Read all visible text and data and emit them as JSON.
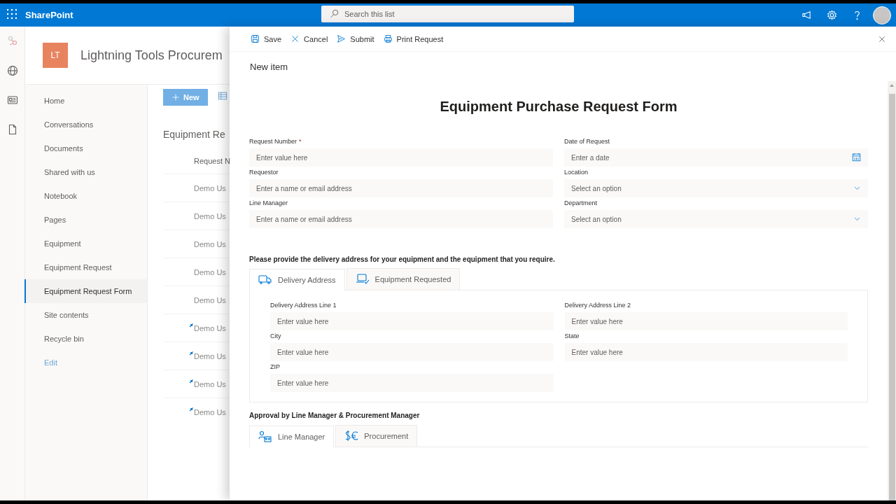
{
  "top_bar": {
    "app_name": "SharePoint",
    "search": {
      "placeholder": "Search this list"
    }
  },
  "site": {
    "logo": "LT",
    "title": "Lightning Tools Procurem"
  },
  "nav": [
    {
      "label": "Home",
      "kind": "page",
      "selected": false
    },
    {
      "label": "Conversations",
      "kind": "page",
      "selected": false
    },
    {
      "label": "Documents",
      "kind": "page",
      "selected": false
    },
    {
      "label": "Shared with us",
      "kind": "page",
      "selected": false
    },
    {
      "label": "Notebook",
      "kind": "page",
      "selected": false
    },
    {
      "label": "Pages",
      "kind": "page",
      "selected": false
    },
    {
      "label": "Equipment",
      "kind": "page",
      "selected": false
    },
    {
      "label": "Equipment Request",
      "kind": "page",
      "selected": false
    },
    {
      "label": "Equipment Request Form",
      "kind": "page",
      "selected": true
    },
    {
      "label": "Site contents",
      "kind": "page",
      "selected": false
    },
    {
      "label": "Recycle bin",
      "kind": "page",
      "selected": false
    },
    {
      "label": "Edit",
      "kind": "link",
      "selected": false
    }
  ],
  "list": {
    "new_button": "New",
    "title": "Equipment Re",
    "column": "Request N",
    "rows": [
      {
        "text": "Demo Us",
        "new": false
      },
      {
        "text": "Demo Us",
        "new": false
      },
      {
        "text": "Demo Us",
        "new": false
      },
      {
        "text": "Demo Us",
        "new": false
      },
      {
        "text": "Demo Us",
        "new": false
      },
      {
        "text": "Demo Us",
        "new": true
      },
      {
        "text": "Demo Us",
        "new": true
      },
      {
        "text": "Demo Us",
        "new": true
      },
      {
        "text": "Demo Us",
        "new": true
      }
    ]
  },
  "panel": {
    "commands": [
      {
        "label": "Save",
        "kind": "save"
      },
      {
        "label": "Cancel",
        "kind": "cancel"
      },
      {
        "label": "Submit",
        "kind": "submit"
      },
      {
        "label": "Print Request",
        "kind": "print"
      }
    ],
    "heading": "New item",
    "form_title": "Equipment Purchase Request Form",
    "fields": [
      {
        "label": "Request Number",
        "required_mark": "*",
        "placeholder": "Enter value here",
        "kind": "text"
      },
      {
        "label": "Date of Request",
        "placeholder": "Enter a date",
        "kind": "date"
      },
      {
        "label": "Requestor",
        "placeholder": "Enter a name or email address",
        "kind": "text"
      },
      {
        "label": "Location",
        "placeholder": "Select an option",
        "kind": "choice"
      },
      {
        "label": "Line Manager",
        "placeholder": "Enter a name or email address",
        "kind": "text"
      },
      {
        "label": "Department",
        "placeholder": "Select an option",
        "kind": "choice"
      }
    ],
    "delivery_intro": "Please provide the delivery address for your equipment and the equipment that you require.",
    "delivery_tabs": [
      {
        "label": "Delivery Address",
        "kind": "truck",
        "selected": true
      },
      {
        "label": "Equipment Requested",
        "kind": "laptop",
        "selected": false
      }
    ],
    "delivery_fields": [
      {
        "label": "Delivery Address Line 1",
        "placeholder": "Enter value here"
      },
      {
        "label": "Delivery Address Line 2",
        "placeholder": "Enter value here"
      },
      {
        "label": "City",
        "placeholder": "Enter value here"
      },
      {
        "label": "State",
        "placeholder": "Enter value here"
      },
      {
        "label": "ZIP",
        "placeholder": "Enter value here"
      }
    ],
    "approval_heading": "Approval by Line Manager & Procurement Manager",
    "approval_tabs": [
      {
        "label": "Line Manager",
        "kind": "people",
        "selected": true
      },
      {
        "label": "Procurement",
        "kind": "currency",
        "selected": false
      }
    ]
  }
}
